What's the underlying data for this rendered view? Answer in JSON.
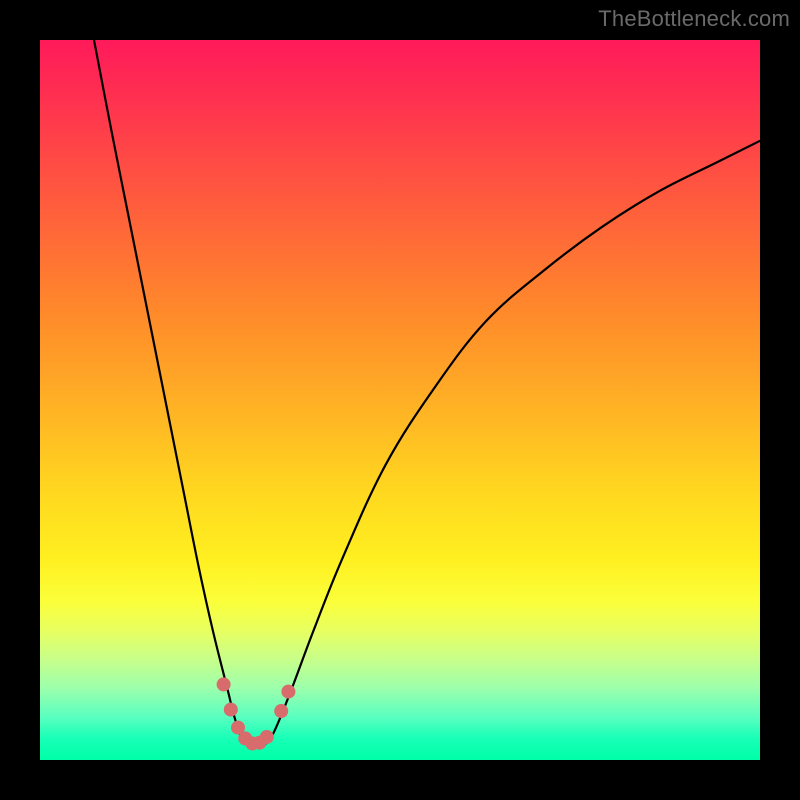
{
  "watermark": "TheBottleneck.com",
  "colors": {
    "page_bg": "#000000",
    "curve_stroke": "#000000",
    "marker_fill": "#d86b6b",
    "watermark_text": "#6a6a6a"
  },
  "chart_data": {
    "type": "line",
    "title": "",
    "xlabel": "",
    "ylabel": "",
    "xlim": [
      0,
      100
    ],
    "ylim": [
      0,
      100
    ],
    "grid": false,
    "series": [
      {
        "name": "bottleneck-curve",
        "x": [
          7.5,
          10,
          12,
          14,
          16,
          18,
          20,
          22,
          24,
          26,
          27,
          28,
          29,
          30,
          31,
          32,
          33,
          35,
          38,
          42,
          48,
          55,
          62,
          70,
          78,
          86,
          94,
          100
        ],
        "values": [
          100,
          87,
          77,
          67,
          57,
          47,
          37,
          27,
          18,
          10,
          6,
          3,
          2,
          2,
          2,
          3,
          5,
          10,
          18,
          28,
          41,
          52,
          61,
          68,
          74,
          79,
          83,
          86
        ]
      }
    ],
    "markers": [
      {
        "x": 25.5,
        "y": 10.5
      },
      {
        "x": 26.5,
        "y": 7.0
      },
      {
        "x": 27.5,
        "y": 4.5
      },
      {
        "x": 28.5,
        "y": 3.0
      },
      {
        "x": 29.5,
        "y": 2.3
      },
      {
        "x": 30.5,
        "y": 2.4
      },
      {
        "x": 31.5,
        "y": 3.2
      },
      {
        "x": 33.5,
        "y": 6.8
      },
      {
        "x": 34.5,
        "y": 9.5
      }
    ],
    "legend": null
  }
}
